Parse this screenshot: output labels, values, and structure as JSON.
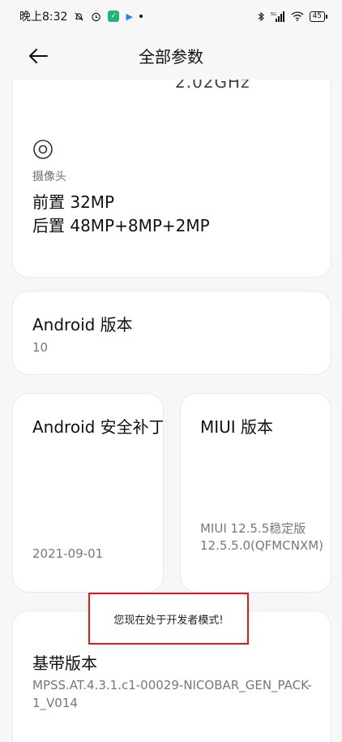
{
  "status_bar": {
    "time": "晚上8:32",
    "battery": "45",
    "network_label": "5G"
  },
  "header": {
    "title": "全部参数"
  },
  "cards": {
    "cpu_tail": "2.02GHz",
    "camera": {
      "label": "摄像头",
      "front": "前置 32MP",
      "rear": "后置 48MP+8MP+2MP"
    },
    "android": {
      "title": "Android 版本",
      "value": "10"
    },
    "security": {
      "title": "Android 安全补丁级别",
      "value": "2021-09-01"
    },
    "miui": {
      "title": "MIUI 版本",
      "value": "MIUI 12.5.5稳定版 12.5.5.0(QFMCNXM)"
    },
    "baseband": {
      "title": "基带版本",
      "value": "MPSS.AT.4.3.1.c1-00029-NICOBAR_GEN_PACK-1_V014"
    }
  },
  "toast": {
    "message": "您现在处于开发者模式!"
  },
  "colors": {
    "highlight": "#d21f26",
    "background": "#f7f7f7"
  }
}
